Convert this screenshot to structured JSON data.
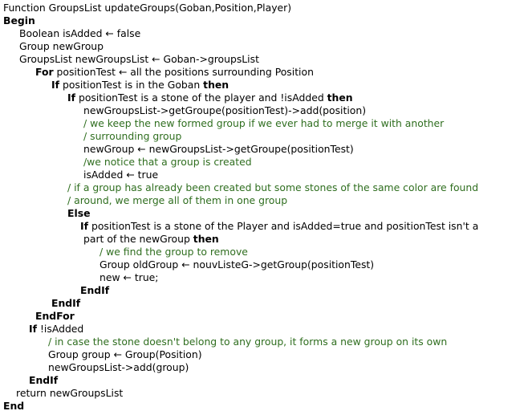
{
  "lines": [
    {
      "indent": 0,
      "parts": [
        {
          "t": "Function GroupsList updateGroups(Goban,Position,Player)",
          "s": "n"
        }
      ]
    },
    {
      "indent": 0,
      "parts": [
        {
          "t": "Begin",
          "s": "k"
        }
      ]
    },
    {
      "indent": 1,
      "parts": [
        {
          "t": "Boolean isAdded ← false",
          "s": "n"
        }
      ]
    },
    {
      "indent": 1,
      "parts": [
        {
          "t": "Group newGroup",
          "s": "n"
        }
      ]
    },
    {
      "indent": 1,
      "parts": [
        {
          "t": "GroupsList newGroupsList ← Goban->groupsList",
          "s": "n"
        }
      ]
    },
    {
      "indent": 2,
      "parts": [
        {
          "t": "For",
          "s": "k"
        },
        {
          "t": " positionTest ← all the positions surrounding Position",
          "s": "n"
        }
      ]
    },
    {
      "indent": 3,
      "parts": [
        {
          "t": "If",
          "s": "k"
        },
        {
          "t": " positionTest is in the Goban ",
          "s": "n"
        },
        {
          "t": "then",
          "s": "k"
        }
      ]
    },
    {
      "indent": 4,
      "parts": [
        {
          "t": "If",
          "s": "k"
        },
        {
          "t": " positionTest is a stone of the player and !isAdded ",
          "s": "n"
        },
        {
          "t": "then",
          "s": "k"
        }
      ]
    },
    {
      "indent": 5,
      "parts": [
        {
          "t": "newGroupsList->getGroupe(positionTest)->add(position)",
          "s": "n"
        }
      ]
    },
    {
      "indent": 5,
      "parts": [
        {
          "t": "/ we keep the new formed group if we ever had to merge it with another",
          "s": "c"
        }
      ]
    },
    {
      "indent": 5,
      "parts": [
        {
          "t": "/ surrounding group",
          "s": "c"
        }
      ]
    },
    {
      "indent": 5,
      "parts": [
        {
          "t": "newGroup ← newGroupsList->getGroupe(positionTest)",
          "s": "n"
        }
      ]
    },
    {
      "indent": 5,
      "parts": [
        {
          "t": "/we notice that a group is created",
          "s": "c"
        }
      ]
    },
    {
      "indent": 5,
      "parts": [
        {
          "t": "isAdded ← true",
          "s": "n"
        }
      ]
    },
    {
      "indent": 4,
      "parts": [
        {
          "t": "/ if a group has already been created but some stones of the same color are found",
          "s": "c"
        }
      ]
    },
    {
      "indent": 4,
      "parts": [
        {
          "t": "/ around, we merge all of them in one group",
          "s": "c"
        }
      ]
    },
    {
      "indent": 4,
      "parts": [
        {
          "t": "Else",
          "s": "k"
        }
      ]
    },
    {
      "indent": 5,
      "parts": [
        {
          "t": "If",
          "s": "k"
        },
        {
          "t": " positionTest is a stone of the Player and isAdded=true and positionTest isn't a",
          "s": "n"
        }
      ]
    },
    {
      "indent": 5,
      "parts": [
        {
          "t": "part of the newGroup ",
          "s": "n"
        },
        {
          "t": "then",
          "s": "k"
        }
      ]
    },
    {
      "indent": 6,
      "parts": [
        {
          "t": "/ we find the group to remove",
          "s": "c"
        }
      ]
    },
    {
      "indent": 6,
      "parts": [
        {
          "t": "Group oldGroup ← nouvListeG->getGroup(positionTest)",
          "s": "n"
        }
      ]
    },
    {
      "indent": 6,
      "parts": [
        {
          "t": "new ← true;",
          "s": "n"
        }
      ]
    },
    {
      "indent": 5,
      "parts": [
        {
          "t": "EndIf",
          "s": "k"
        }
      ]
    },
    {
      "indent": 3,
      "parts": [
        {
          "t": "EndIf",
          "s": "k"
        }
      ]
    },
    {
      "indent": 2,
      "parts": [
        {
          "t": "EndFor",
          "s": "k"
        }
      ]
    },
    {
      "indent": 1,
      "parts": [
        {
          "t": "If",
          "s": "k"
        },
        {
          "t": " !isAdded",
          "s": "n"
        }
      ]
    },
    {
      "indent": 2,
      "parts": [
        {
          "t": "/ in case the stone doesn't belong to any group, it forms a new group on its own",
          "s": "c"
        }
      ]
    },
    {
      "indent": 2,
      "parts": [
        {
          "t": "Group group ← Group(Position)",
          "s": "n"
        }
      ]
    },
    {
      "indent": 2,
      "parts": [
        {
          "t": "newGroupsList->add(group)",
          "s": "n"
        }
      ]
    },
    {
      "indent": 1,
      "parts": [
        {
          "t": "EndIf",
          "s": "k"
        }
      ]
    },
    {
      "indent": 1,
      "parts": [
        {
          "t": "return newGroupsList",
          "s": "n"
        }
      ]
    },
    {
      "indent": 0,
      "parts": [
        {
          "t": "End",
          "s": "k"
        }
      ]
    }
  ]
}
